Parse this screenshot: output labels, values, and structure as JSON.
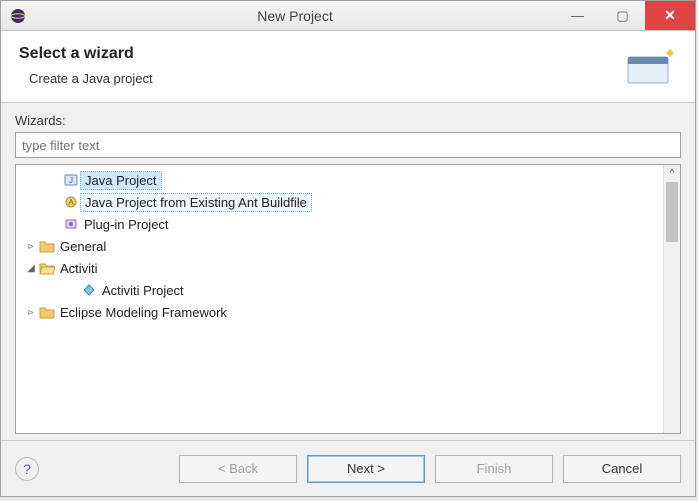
{
  "titlebar": {
    "title": "New Project"
  },
  "header": {
    "heading": "Select a wizard",
    "description": "Create a Java project"
  },
  "body": {
    "wizards_label": "Wizards:",
    "filter_placeholder": "type filter text"
  },
  "tree": {
    "items": [
      {
        "label": "Java Project",
        "kind": "java",
        "selected": true
      },
      {
        "label": "Java Project from Existing Ant Buildfile",
        "kind": "ant",
        "highlight": true
      },
      {
        "label": "Plug-in Project",
        "kind": "plugin"
      },
      {
        "label": "General",
        "kind": "folder",
        "expander": "▹"
      },
      {
        "label": "Activiti",
        "kind": "folder-open",
        "expander": "◢"
      },
      {
        "label": "Activiti Project",
        "kind": "activiti",
        "indent": 2
      },
      {
        "label": "Eclipse Modeling Framework",
        "kind": "folder",
        "expander": "▹"
      }
    ]
  },
  "buttons": {
    "back": "< Back",
    "next": "Next >",
    "finish": "Finish",
    "cancel": "Cancel"
  }
}
